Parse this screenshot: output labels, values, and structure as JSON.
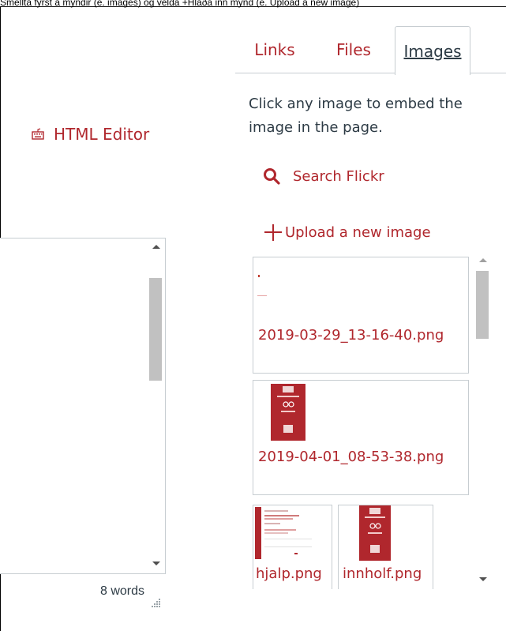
{
  "top_caption": "Smellta fyrst á myndir (e. images) og velda +Hlaða inn mynd (e. Upload a new image)",
  "toolbar": {
    "html_editor_label": "HTML Editor"
  },
  "editor": {
    "word_count": "8 words"
  },
  "tabs": [
    {
      "label": "Links"
    },
    {
      "label": "Files"
    },
    {
      "label": "Images",
      "active": true
    }
  ],
  "images_panel": {
    "instructions": "Click any image to embed the image in the page.",
    "search_flickr_label": "Search Flickr",
    "upload_label": "Upload a new image",
    "images": [
      {
        "name": "2019-03-29_13-16-40.png"
      },
      {
        "name": "2019-04-01_08-53-38.png"
      },
      {
        "name": "hjalp.png"
      },
      {
        "name": "innholf.png"
      }
    ]
  },
  "colors": {
    "link": "#b0272d",
    "text": "#2d3b45",
    "border": "#c7cdd1"
  }
}
